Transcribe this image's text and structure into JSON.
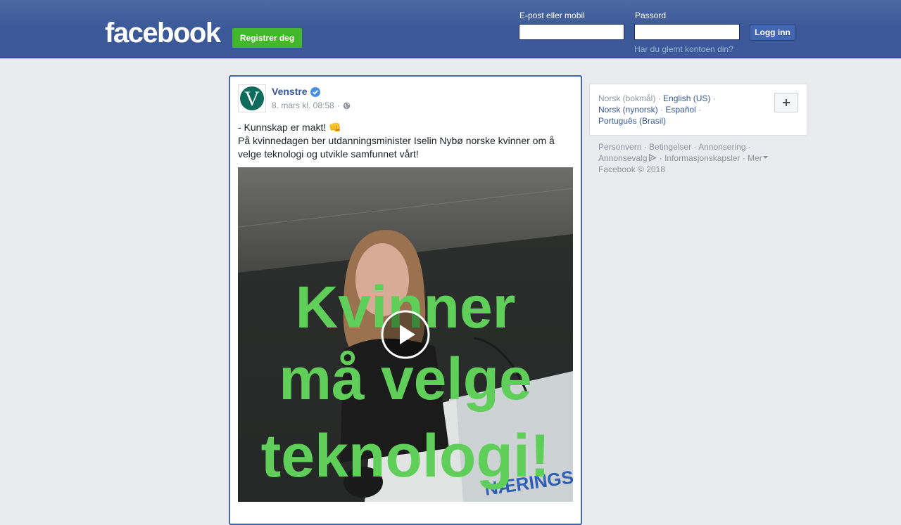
{
  "header": {
    "logo_text": "facebook",
    "register_label": "Registrer deg",
    "email_label": "E-post eller mobil",
    "email_value": "",
    "password_label": "Passord",
    "password_value": "",
    "login_label": "Logg inn",
    "forgot_label": "Har du glemt kontoen din?"
  },
  "post": {
    "page_name": "Venstre",
    "timestamp": "8. mars kl. 08:58",
    "meta_separator": "·",
    "text_line1": "- Kunnskap er makt! 👊",
    "text_line2": "På kvinnedagen ber utdanningsminister Iselin Nybø norske kvinner om å velge teknologi og utvikle samfunnet vårt!",
    "video_overlay": [
      "Kvinner",
      "må velge",
      "teknologi!"
    ],
    "video_podium_text": "NÆRINGSLI",
    "avatar_letter": "V"
  },
  "languages": {
    "current": "Norsk (bokmål)",
    "items": [
      "English (US)",
      "Norsk (nynorsk)",
      "Español",
      "Português (Brasil)"
    ]
  },
  "footer": {
    "links": [
      "Personvern",
      "Betingelser",
      "Annonsering",
      "Annonsevalg",
      "Informasjonskapsler",
      "Mer"
    ],
    "copyright": "Facebook © 2018"
  },
  "colors": {
    "brand_blue": "#3b5998",
    "register_green": "#42b72a",
    "overlay_green": "#5fcf5a",
    "avatar_teal": "#0f6b5c"
  },
  "icons": [
    "verified-badge-icon",
    "globe-icon",
    "play-icon",
    "plus-icon",
    "adchoices-icon",
    "caret-down-icon"
  ]
}
